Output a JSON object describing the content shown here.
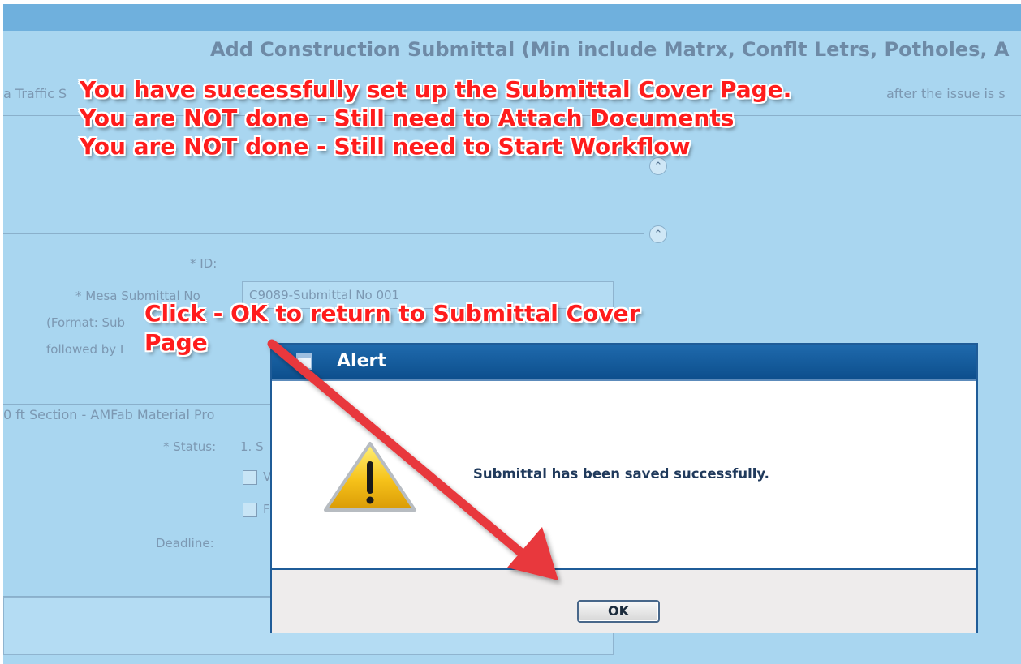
{
  "page": {
    "title": "Add Construction Submittal (Min include Matrx, Conflt Letrs, Potholes, A",
    "info_left": "a Traffic S",
    "info_right": "after the issue is s"
  },
  "form": {
    "id_label": "* ID:",
    "submittal_no_label": "* Mesa Submittal No",
    "submittal_no_value": "C9089-Submittal No 001",
    "format_label": "(Format: Sub",
    "followed_by_label": "followed by I",
    "section_text": "0 ft Section - AMFab Material Pro",
    "status_label": "* Status:",
    "status_value": "1. S",
    "checkbox_1": "V",
    "checkbox_2": "F",
    "deadline_label": "Deadline:"
  },
  "callouts": {
    "top_lines": [
      "You have successfully set up the Submittal Cover Page.",
      "You are NOT done - Still need to Attach Documents",
      "You are NOT done - Still need to Start Workflow"
    ],
    "click_lines": [
      "Click - OK to return to Submittal Cover",
      "Page"
    ],
    "color": "#ff1c1c"
  },
  "alert": {
    "title": "Alert",
    "message": "Submittal has been saved successfully.",
    "ok_label": "OK",
    "icon": "warning-icon"
  },
  "colors": {
    "background": "#a9d6f0",
    "titlebar": "#1f6aad",
    "arrow": "#e8383d"
  }
}
